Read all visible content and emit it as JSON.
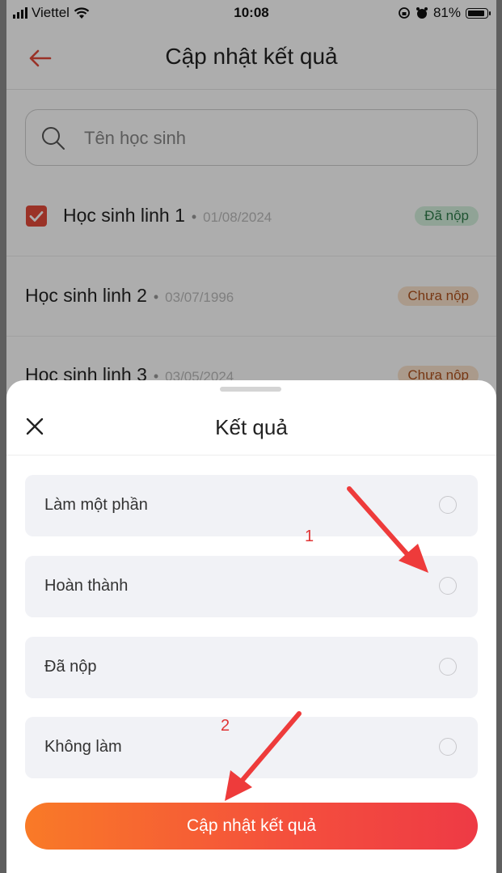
{
  "status_bar": {
    "carrier": "Viettel",
    "time": "10:08",
    "battery": "81%"
  },
  "header": {
    "title": "Cập nhật kết quả"
  },
  "search": {
    "placeholder": "Tên học sinh"
  },
  "students": [
    {
      "name": "Học sinh linh 1",
      "date": "01/08/2024",
      "status": "Đã nộp",
      "checked": true
    },
    {
      "name": "Học sinh linh 2",
      "date": "03/07/1996",
      "status": "Chưa nộp",
      "checked": false
    },
    {
      "name": "Học sinh linh 3",
      "date": "03/05/2024",
      "status": "Chưa nộp",
      "checked": false
    }
  ],
  "sheet": {
    "title": "Kết quả",
    "options": [
      {
        "label": "Làm một phần"
      },
      {
        "label": "Hoàn thành"
      },
      {
        "label": "Đã nộp"
      },
      {
        "label": "Không làm"
      }
    ],
    "submit_label": "Cập nhật kết quả"
  },
  "annotations": {
    "marker_1": "1",
    "marker_2": "2"
  },
  "colors": {
    "accent": "#e34a3a",
    "arrow": "#ee3b3b",
    "button_start": "#f97a27",
    "button_end": "#ee3a45"
  }
}
